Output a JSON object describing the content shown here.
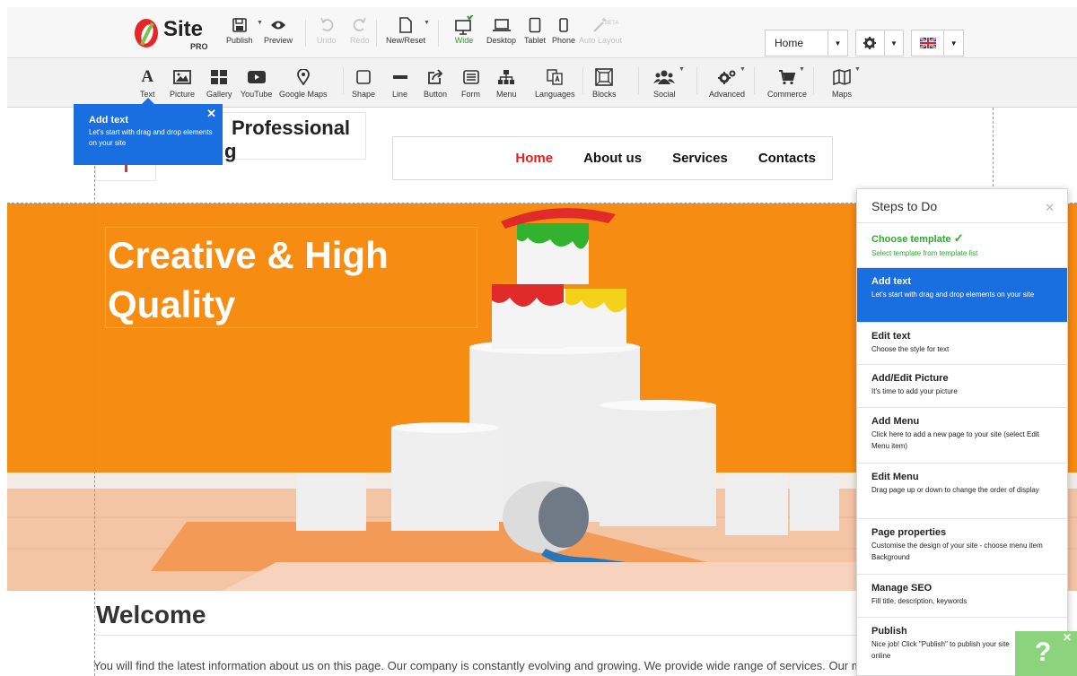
{
  "toolbar": {
    "brand": "Site",
    "brand_edition": "PRO",
    "actions": [
      {
        "label": "Publish",
        "icon": "save-icon"
      },
      {
        "label": "Preview",
        "icon": "eye-icon"
      },
      {
        "label": "Undo",
        "icon": "undo-icon"
      },
      {
        "label": "Redo",
        "icon": "redo-icon"
      },
      {
        "label": "New/Reset",
        "icon": "new-page-icon"
      },
      {
        "label": "Wide",
        "icon": "monitor-icon"
      },
      {
        "label": "Desktop",
        "icon": "laptop-icon"
      },
      {
        "label": "Tablet",
        "icon": "tablet-icon"
      },
      {
        "label": "Phone",
        "icon": "phone-icon"
      },
      {
        "label": "Auto Layout",
        "icon": "magic-wand-icon"
      }
    ],
    "beta_tag": "BETA",
    "page_select_value": "Home"
  },
  "elements": [
    {
      "label": "Text",
      "icon": "text-icon"
    },
    {
      "label": "Picture",
      "icon": "picture-icon"
    },
    {
      "label": "Gallery",
      "icon": "gallery-icon"
    },
    {
      "label": "YouTube",
      "icon": "youtube-icon"
    },
    {
      "label": "Google Maps",
      "icon": "map-pin-icon"
    },
    {
      "label": "Shape",
      "icon": "shape-icon"
    },
    {
      "label": "Line",
      "icon": "line-icon"
    },
    {
      "label": "Button",
      "icon": "button-icon"
    },
    {
      "label": "Form",
      "icon": "form-icon"
    },
    {
      "label": "Menu",
      "icon": "menu-tree-icon"
    },
    {
      "label": "Languages",
      "icon": "languages-icon"
    },
    {
      "label": "Blocks",
      "icon": "blocks-icon"
    },
    {
      "label": "Social",
      "icon": "social-icon"
    },
    {
      "label": "Advanced",
      "icon": "gears-icon"
    },
    {
      "label": "Commerce",
      "icon": "cart-icon"
    },
    {
      "label": "Maps",
      "icon": "map-icon"
    }
  ],
  "tooltip": {
    "title": "Add text",
    "desc": "Let's start with drag and drop elements on your site"
  },
  "site": {
    "title_line1": "Professional",
    "title_line2": "g",
    "nav": [
      "Home",
      "About us",
      "Services",
      "Contacts"
    ],
    "hero_line1": "Creative & High",
    "hero_line2": "Quality",
    "welcome": "Welcome",
    "intro": "You will find the latest information about us on this page. Our company is constantly evolving and growing. We provide wide range of services. Our mission is to provide full assistance"
  },
  "steps": {
    "title": "Steps to Do",
    "items": [
      {
        "title": "Choose template",
        "desc": "Select template from template list",
        "state": "done"
      },
      {
        "title": "Add text",
        "desc": "Let's start with drag and drop elements on your site",
        "state": "active"
      },
      {
        "title": "Edit text",
        "desc": "Choose the style for text",
        "state": ""
      },
      {
        "title": "Add/Edit Picture",
        "desc": "It's time to add your picture",
        "state": ""
      },
      {
        "title": "Add Menu",
        "desc": "Click here to add a new page to your site (select Edit Menu item)",
        "state": ""
      },
      {
        "title": "Edit Menu",
        "desc": "Drag page up or down to change the order of display",
        "state": ""
      },
      {
        "title": "Page properties",
        "desc": "Customise the design of your site - choose menu item Background",
        "state": ""
      },
      {
        "title": "Manage SEO",
        "desc": "Fill title, description, keywords",
        "state": ""
      },
      {
        "title": "Publish",
        "desc": "Nice job! Click \"Publish\" to publish your site online",
        "state": ""
      }
    ]
  },
  "help_label": "?",
  "colors": {
    "accent_blue": "#1a6fe0",
    "done_green": "#2ea82e",
    "hero_orange": "#f58b10",
    "nav_active": "#e81d1d"
  }
}
